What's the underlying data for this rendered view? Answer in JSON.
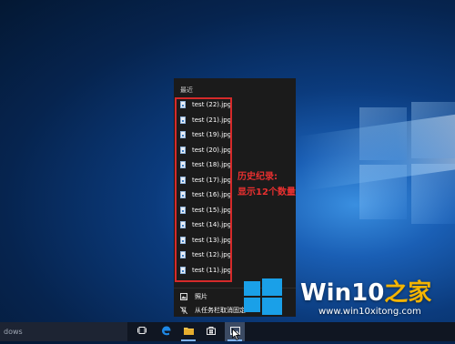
{
  "jumplist": {
    "header": "最近",
    "items": [
      {
        "label": "test (22).jpg"
      },
      {
        "label": "test (21).jpg"
      },
      {
        "label": "test (19).jpg"
      },
      {
        "label": "test (20).jpg"
      },
      {
        "label": "test (18).jpg"
      },
      {
        "label": "test (17).jpg"
      },
      {
        "label": "test (16).jpg"
      },
      {
        "label": "test (15).jpg"
      },
      {
        "label": "test (14).jpg"
      },
      {
        "label": "test (13).jpg"
      },
      {
        "label": "test (12).jpg"
      },
      {
        "label": "test (11).jpg"
      }
    ],
    "app_label": "照片",
    "unpin_label": "从任务栏取消固定"
  },
  "annotation": {
    "line1": "历史纪录:",
    "line2": "显示12个数量",
    "color": "#e83030"
  },
  "taskbar": {
    "search_text": "dows"
  },
  "watermark": {
    "title_main": "Win10",
    "title_accent": "之家",
    "url": "www.win10xitong.com"
  },
  "colors": {
    "accent": "#1aa0e8",
    "annotation_red": "#d52a2a"
  }
}
